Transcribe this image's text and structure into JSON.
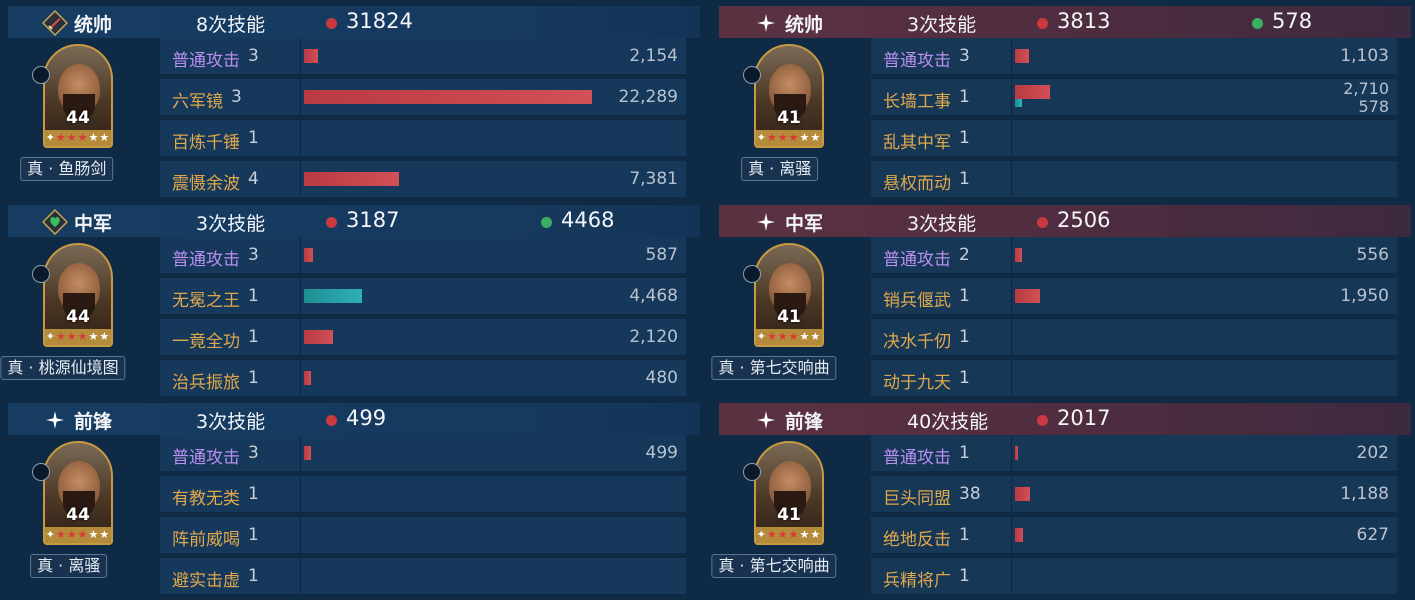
{
  "colors": {
    "damage": "#c9393f",
    "heal": "#3cae62",
    "bar_damage": "#c9434b",
    "bar_heal": "#28a3a8",
    "skill_basic": "#b98ff0",
    "skill_other": "#e0a84c"
  },
  "left": [
    {
      "role": "统帅",
      "role_icon": "sword-icon",
      "count": "8次技能",
      "damage": "31824",
      "heal": null,
      "hero": {
        "level": "44",
        "tag": "真 · 鱼肠剑",
        "stars_red": 3,
        "stars_total": 5
      },
      "skills": [
        {
          "name": "普通攻击",
          "level": "3",
          "basic": true,
          "value": "2,154",
          "ratio": 0.05
        },
        {
          "name": "六军镜",
          "level": "3",
          "basic": false,
          "value": "22,289",
          "ratio": 1.0
        },
        {
          "name": "百炼千锤",
          "level": "1",
          "basic": false,
          "value": "",
          "ratio": 0
        },
        {
          "name": "震慑余波",
          "level": "4",
          "basic": false,
          "value": "7,381",
          "ratio": 0.33
        }
      ]
    },
    {
      "role": "中军",
      "role_icon": "heart-icon",
      "count": "3次技能",
      "damage": "3187",
      "heal": "4468",
      "hero": {
        "level": "44",
        "tag": "真 · 桃源仙境图",
        "stars_red": 3,
        "stars_total": 5
      },
      "skills": [
        {
          "name": "普通攻击",
          "level": "3",
          "basic": true,
          "value": "587",
          "ratio": 0.03
        },
        {
          "name": "无冕之王",
          "level": "1",
          "basic": false,
          "value": "4,468",
          "ratio": 0.2,
          "heal": true
        },
        {
          "name": "一竟全功",
          "level": "1",
          "basic": false,
          "value": "2,120",
          "ratio": 0.1
        },
        {
          "name": "治兵振旅",
          "level": "1",
          "basic": false,
          "value": "480",
          "ratio": 0.025
        }
      ]
    },
    {
      "role": "前锋",
      "role_icon": "star-icon",
      "count": "3次技能",
      "damage": "499",
      "heal": null,
      "hero": {
        "level": "44",
        "tag": "真 · 离骚",
        "stars_red": 3,
        "stars_total": 5
      },
      "skills": [
        {
          "name": "普通攻击",
          "level": "3",
          "basic": true,
          "value": "499",
          "ratio": 0.025
        },
        {
          "name": "有教无类",
          "level": "1",
          "basic": false,
          "value": "",
          "ratio": 0
        },
        {
          "name": "阵前威喝",
          "level": "1",
          "basic": false,
          "value": "",
          "ratio": 0
        },
        {
          "name": "避实击虚",
          "level": "1",
          "basic": false,
          "value": "",
          "ratio": 0
        }
      ]
    }
  ],
  "right": [
    {
      "role": "统帅",
      "role_icon": "star-icon",
      "count": "3次技能",
      "damage": "3813",
      "heal": "578",
      "hero": {
        "level": "41",
        "tag": "真 · 离骚",
        "stars_red": 3,
        "stars_total": 5
      },
      "skills": [
        {
          "name": "普通攻击",
          "level": "3",
          "basic": true,
          "value": "1,103",
          "ratio": 0.05
        },
        {
          "name": "长墙工事",
          "level": "1",
          "basic": false,
          "value": "2,710",
          "value2": "578",
          "ratio": 0.12,
          "ratio2": 0.026
        },
        {
          "name": "乱其中军",
          "level": "1",
          "basic": false,
          "value": "",
          "ratio": 0
        },
        {
          "name": "悬权而动",
          "level": "1",
          "basic": false,
          "value": "",
          "ratio": 0
        }
      ]
    },
    {
      "role": "中军",
      "role_icon": "star-icon",
      "count": "3次技能",
      "damage": "2506",
      "heal": null,
      "hero": {
        "level": "41",
        "tag": "真 · 第七交响曲",
        "stars_red": 3,
        "stars_total": 5
      },
      "skills": [
        {
          "name": "普通攻击",
          "level": "2",
          "basic": true,
          "value": "556",
          "ratio": 0.025
        },
        {
          "name": "销兵偃武",
          "level": "1",
          "basic": false,
          "value": "1,950",
          "ratio": 0.087
        },
        {
          "name": "决水千仞",
          "level": "1",
          "basic": false,
          "value": "",
          "ratio": 0
        },
        {
          "name": "动于九天",
          "level": "1",
          "basic": false,
          "value": "",
          "ratio": 0
        }
      ]
    },
    {
      "role": "前锋",
      "role_icon": "star-icon",
      "count": "40次技能",
      "damage": "2017",
      "heal": null,
      "hero": {
        "level": "41",
        "tag": "真 · 第七交响曲",
        "stars_red": 3,
        "stars_total": 5
      },
      "skills": [
        {
          "name": "普通攻击",
          "level": "1",
          "basic": true,
          "value": "202",
          "ratio": 0.01
        },
        {
          "name": "巨头同盟",
          "level": "38",
          "basic": false,
          "value": "1,188",
          "ratio": 0.053
        },
        {
          "name": "绝地反击",
          "level": "1",
          "basic": false,
          "value": "627",
          "ratio": 0.028
        },
        {
          "name": "兵精将广",
          "level": "1",
          "basic": false,
          "value": "",
          "ratio": 0
        }
      ]
    }
  ]
}
